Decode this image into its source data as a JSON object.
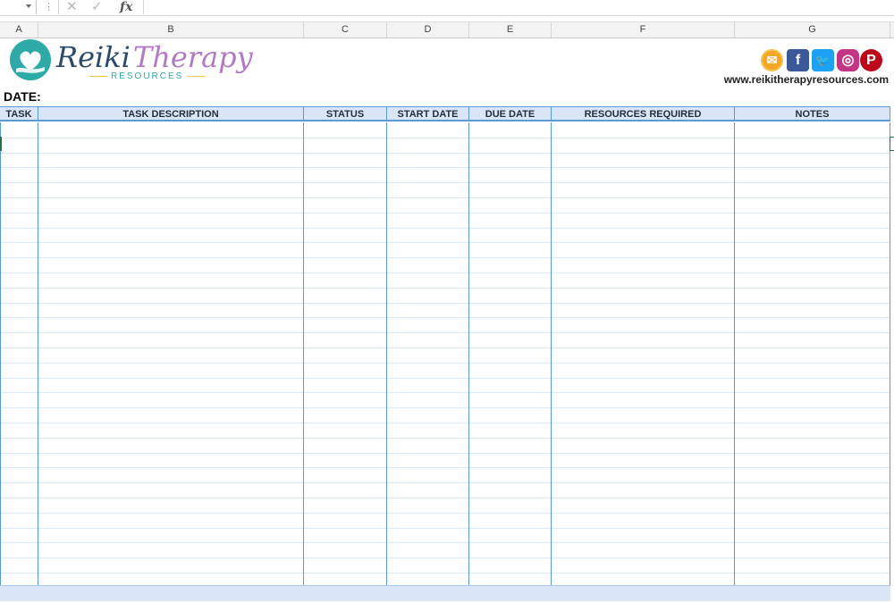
{
  "formula_bar": {
    "cancel_glyph": "✕",
    "enter_glyph": "✓",
    "fx_label": "fx",
    "value": ""
  },
  "columns": [
    "A",
    "B",
    "C",
    "D",
    "E",
    "F",
    "G"
  ],
  "logo": {
    "word1": "Reiki",
    "word2": "Therapy",
    "subtitle": "RESOURCES",
    "colors": {
      "teal": "#2da9a6",
      "navy": "#2b4a6a",
      "purple": "#b279c4"
    }
  },
  "social": {
    "icons": [
      "email-icon",
      "facebook-icon",
      "twitter-icon",
      "instagram-icon",
      "pinterest-icon"
    ],
    "glyphs": {
      "email": "✉",
      "facebook": "f",
      "twitter": "🐦",
      "instagram": "◎",
      "pinterest": "P"
    },
    "website": "www.reikitherapyresources.com"
  },
  "date_label": "DATE:",
  "table": {
    "headers": [
      "TASK",
      "TASK DESCRIPTION",
      "STATUS",
      "START DATE",
      "DUE DATE",
      "RESOURCES REQUIRED",
      "NOTES"
    ],
    "header_fill": "#d9e6f5",
    "border_color": "#5b9bd5",
    "row_count": 31,
    "rows": []
  }
}
